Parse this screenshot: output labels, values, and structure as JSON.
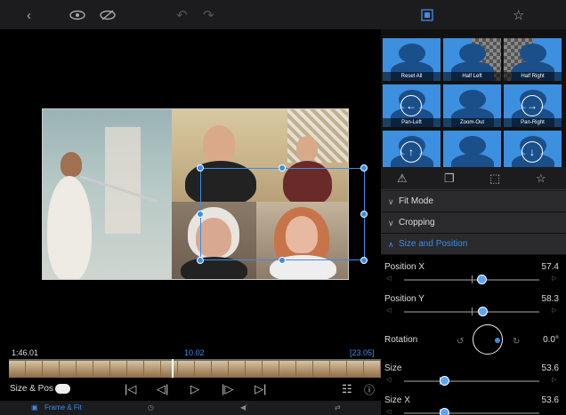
{
  "toolbar": {
    "icons": [
      "back-chevron-icon",
      "eye-icon",
      "eye-slash-icon",
      "undo-icon",
      "redo-icon",
      "transform-icon",
      "star-icon"
    ]
  },
  "timeline": {
    "current_time": "1:46.01",
    "clip_time": "10.02",
    "clip_duration": "[23.05]"
  },
  "controls": {
    "size_pos_label": "Size & Pos"
  },
  "bottom_tabs": {
    "frame_fit": "Frame & Fit"
  },
  "presets": [
    {
      "label": "Reset All"
    },
    {
      "label": "Half Left"
    },
    {
      "label": "Half Right"
    },
    {
      "label": "Pan-Left"
    },
    {
      "label": "Zoom-Out"
    },
    {
      "label": "Pan-Right"
    },
    {
      "label": ""
    },
    {
      "label": ""
    },
    {
      "label": ""
    }
  ],
  "sections": {
    "fit_mode": "Fit Mode",
    "cropping": "Cropping",
    "size_position": "Size and Position"
  },
  "properties": {
    "position_x": {
      "label": "Position X",
      "value": "57.4",
      "level": 0.574
    },
    "position_y": {
      "label": "Position Y",
      "value": "58.3",
      "level": 0.583
    },
    "rotation": {
      "label": "Rotation",
      "value": "0.0°"
    },
    "size": {
      "label": "Size",
      "value": "53.6",
      "level": 0.3
    },
    "size_x": {
      "label": "Size X",
      "value": "53.6",
      "level": 0.3
    }
  },
  "colors": {
    "accent": "#3a8eea",
    "panel_bg": "#1c1c1e",
    "preset_bg": "#3d8fe0"
  }
}
